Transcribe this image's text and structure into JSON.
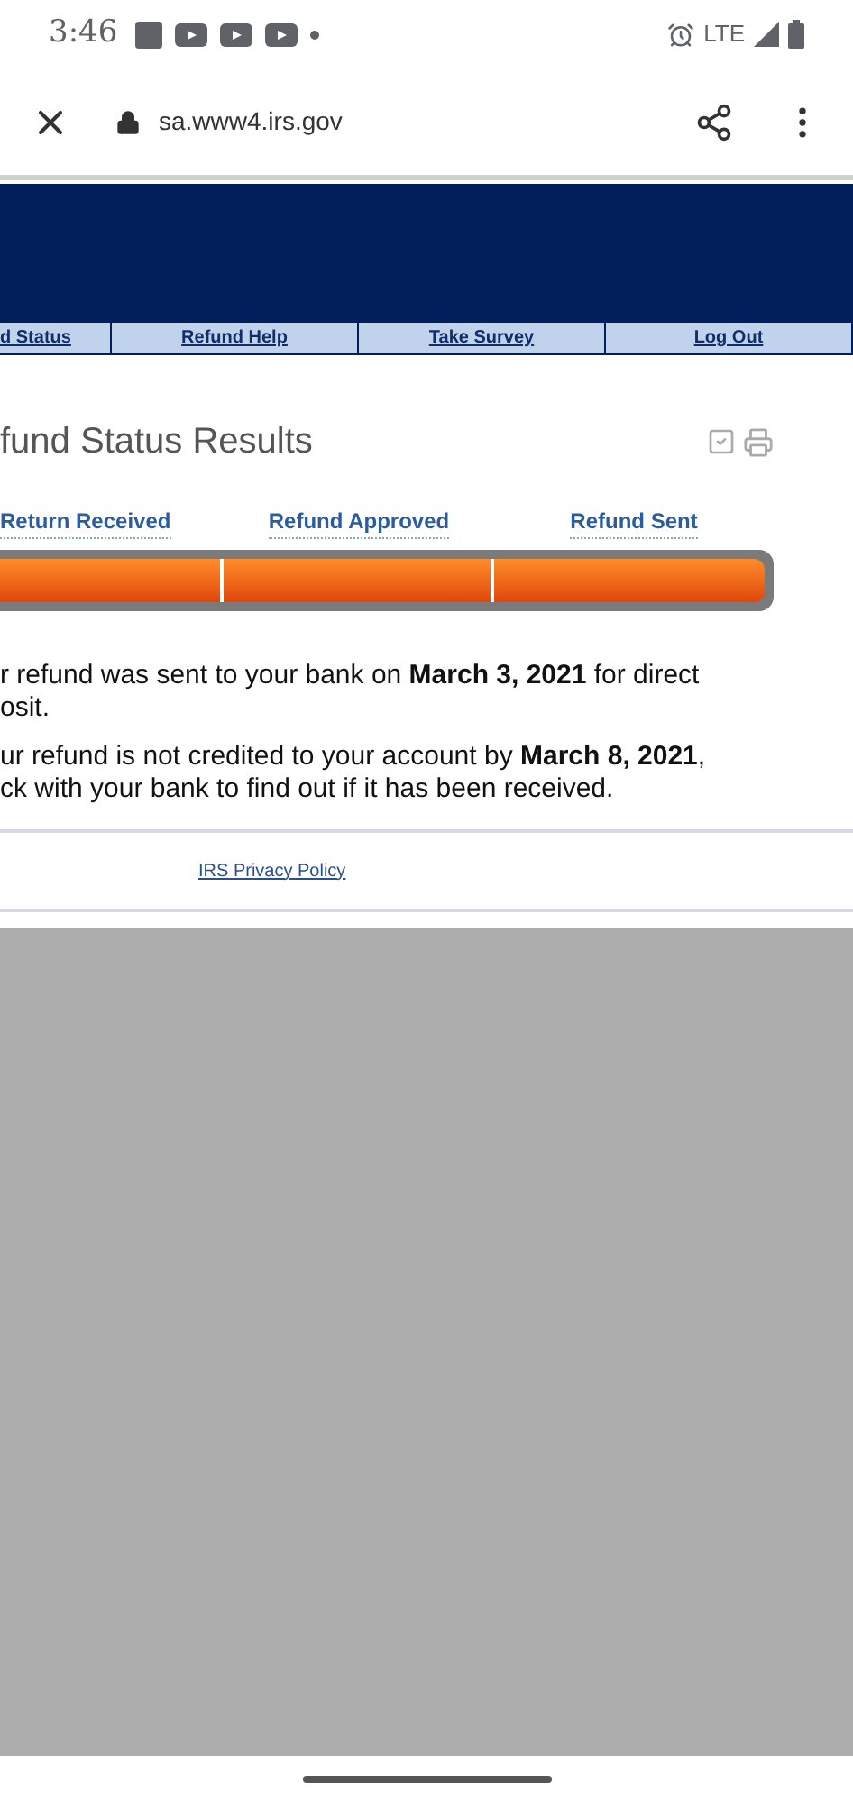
{
  "status_bar": {
    "time": "3:46",
    "network": "LTE"
  },
  "browser": {
    "url": "sa.www4.irs.gov"
  },
  "nav_tabs": [
    {
      "label": "d Status"
    },
    {
      "label": "Refund Help"
    },
    {
      "label": "Take Survey"
    },
    {
      "label": "Log Out"
    }
  ],
  "title": "fund Status Results",
  "progress": {
    "steps": [
      {
        "label": "Return Received"
      },
      {
        "label": "Refund Approved"
      },
      {
        "label": "Refund Sent"
      }
    ]
  },
  "paragraphs": [
    {
      "lines": [
        "r refund was sent to your bank on **March 3, 2021** for direct",
        "osit."
      ]
    },
    {
      "lines": [
        "ur refund is not credited to your account by **March 8, 2021**,",
        "ck with your bank to find out if it has been received."
      ]
    }
  ],
  "footer_link": "IRS Privacy Policy"
}
